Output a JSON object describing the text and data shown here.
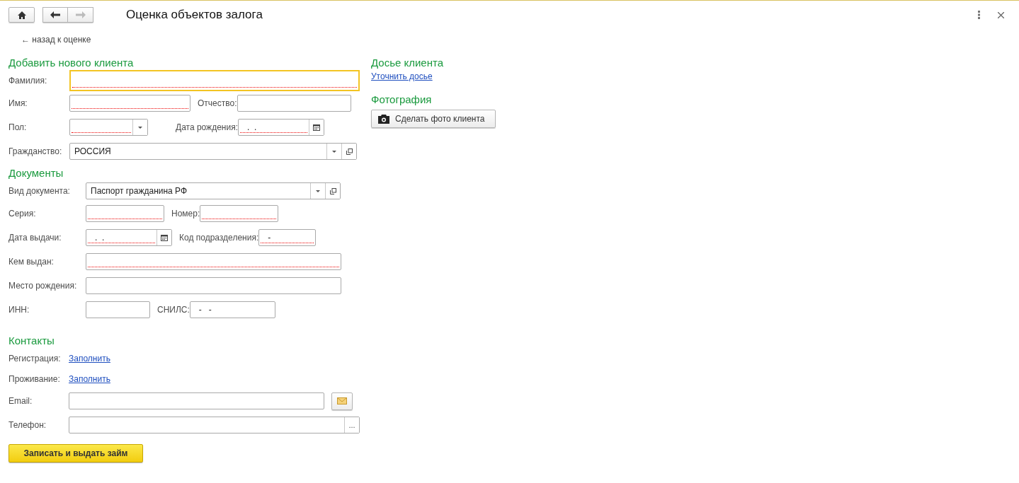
{
  "toolbar": {
    "title": "Оценка объектов залога",
    "back_enabled": true,
    "forward_enabled": false
  },
  "back_link": "← назад к оценке",
  "client": {
    "heading": "Добавить нового клиента",
    "rows": [
      {
        "fields": [
          {
            "label": "Фамилия:",
            "kind": "text",
            "required": true,
            "focused": true
          }
        ]
      },
      {
        "fields": [
          {
            "label": "Имя:",
            "kind": "text",
            "required": true,
            "focused": false
          },
          {
            "label": "Отчество:",
            "kind": "text",
            "required": false,
            "focused": false
          }
        ]
      },
      {
        "fields": [
          {
            "label": "Пол:",
            "kind": "select",
            "required": true,
            "focused": false
          },
          {
            "label": "Дата рождения:",
            "kind": "date",
            "value": ".  .",
            "required": true,
            "focused": false
          }
        ]
      },
      {
        "fields": [
          {
            "label": "Гражданство:",
            "kind": "select_open",
            "value": "РОССИЯ",
            "required": false,
            "focused": false
          }
        ]
      }
    ]
  },
  "documents": {
    "heading": "Документы",
    "rows": [
      {
        "fields": [
          {
            "label": "Вид документа:",
            "kind": "select_open",
            "value": "Паспорт гражданина РФ",
            "required": false,
            "focused": false
          }
        ]
      },
      {
        "fields": [
          {
            "label": "Серия:",
            "kind": "text",
            "required": true,
            "focused": false
          },
          {
            "label": "Номер:",
            "kind": "text",
            "required": true,
            "focused": false
          }
        ]
      },
      {
        "fields": [
          {
            "label": "Дата выдачи:",
            "kind": "date",
            "value": ".  .",
            "required": true,
            "focused": false
          },
          {
            "label": "Код подразделения:",
            "kind": "text",
            "value": "-",
            "required": true,
            "focused": false
          }
        ]
      },
      {
        "fields": [
          {
            "label": "Кем выдан:",
            "kind": "text",
            "required": true,
            "focused": false
          }
        ]
      },
      {
        "fields": [
          {
            "label": "Место рождения:",
            "kind": "text",
            "required": false,
            "focused": false
          }
        ]
      },
      {
        "fields": [
          {
            "label": "ИНН:",
            "kind": "text",
            "required": false,
            "focused": false
          },
          {
            "label": "СНИЛС:",
            "kind": "text",
            "value": "-   -",
            "required": false,
            "focused": false
          }
        ]
      }
    ]
  },
  "contacts": {
    "heading": "Контакты",
    "rows": [
      {
        "fields": [
          {
            "label": "Регистрация:",
            "kind": "link",
            "value": "Заполнить"
          }
        ]
      },
      {
        "fields": [
          {
            "label": "Проживание:",
            "kind": "link",
            "value": "Заполнить"
          }
        ]
      },
      {
        "fields": [
          {
            "label": "Email:",
            "kind": "email",
            "required": false,
            "focused": false
          }
        ]
      },
      {
        "fields": [
          {
            "label": "Телефон:",
            "kind": "phone",
            "button_text": "...",
            "required": false,
            "focused": false
          }
        ]
      }
    ]
  },
  "submit_button": "Записать и выдать займ",
  "dossier": {
    "heading": "Досье клиента",
    "link": "Уточнить досье"
  },
  "photo": {
    "heading": "Фотография",
    "button": "Сделать фото клиента"
  }
}
